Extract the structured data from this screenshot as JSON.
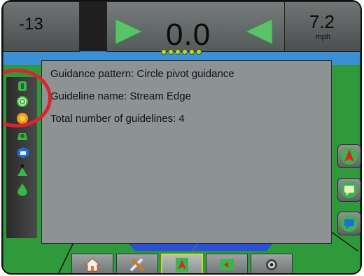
{
  "header": {
    "cross_track": "-13",
    "deviation": "0.0",
    "speed_value": "7.2",
    "speed_unit": "mph",
    "led_count": 6
  },
  "info_panel": {
    "lines": [
      "Guidance pattern: Circle pivot guidance",
      "Guideline name: Stream Edge",
      "Total number of guidelines: 4"
    ]
  },
  "left_toolbar": {
    "icons": [
      "guideline-icon",
      "circle-pivot-icon",
      "pivot-center-icon",
      "tractor-icon",
      "vehicle-view-icon",
      "a-point-icon",
      "drop-icon"
    ]
  },
  "right_toolbar": {
    "icons": [
      "heading-arrow-icon",
      "chat-icon",
      "message-icon"
    ]
  },
  "bottom_bar": {
    "tabs": [
      "home-icon",
      "tools-icon",
      "guidance-icon",
      "map-icon",
      "camera-icon"
    ],
    "active": "guidance-icon"
  },
  "colors": {
    "arrow_green": "#5cc26a",
    "led_green": "#b6d83a",
    "sky_blue": "#3b8fd4",
    "grass_green": "#2f9a3b",
    "panel_gray": "#8d9293",
    "highlight_red": "#d9262d"
  }
}
